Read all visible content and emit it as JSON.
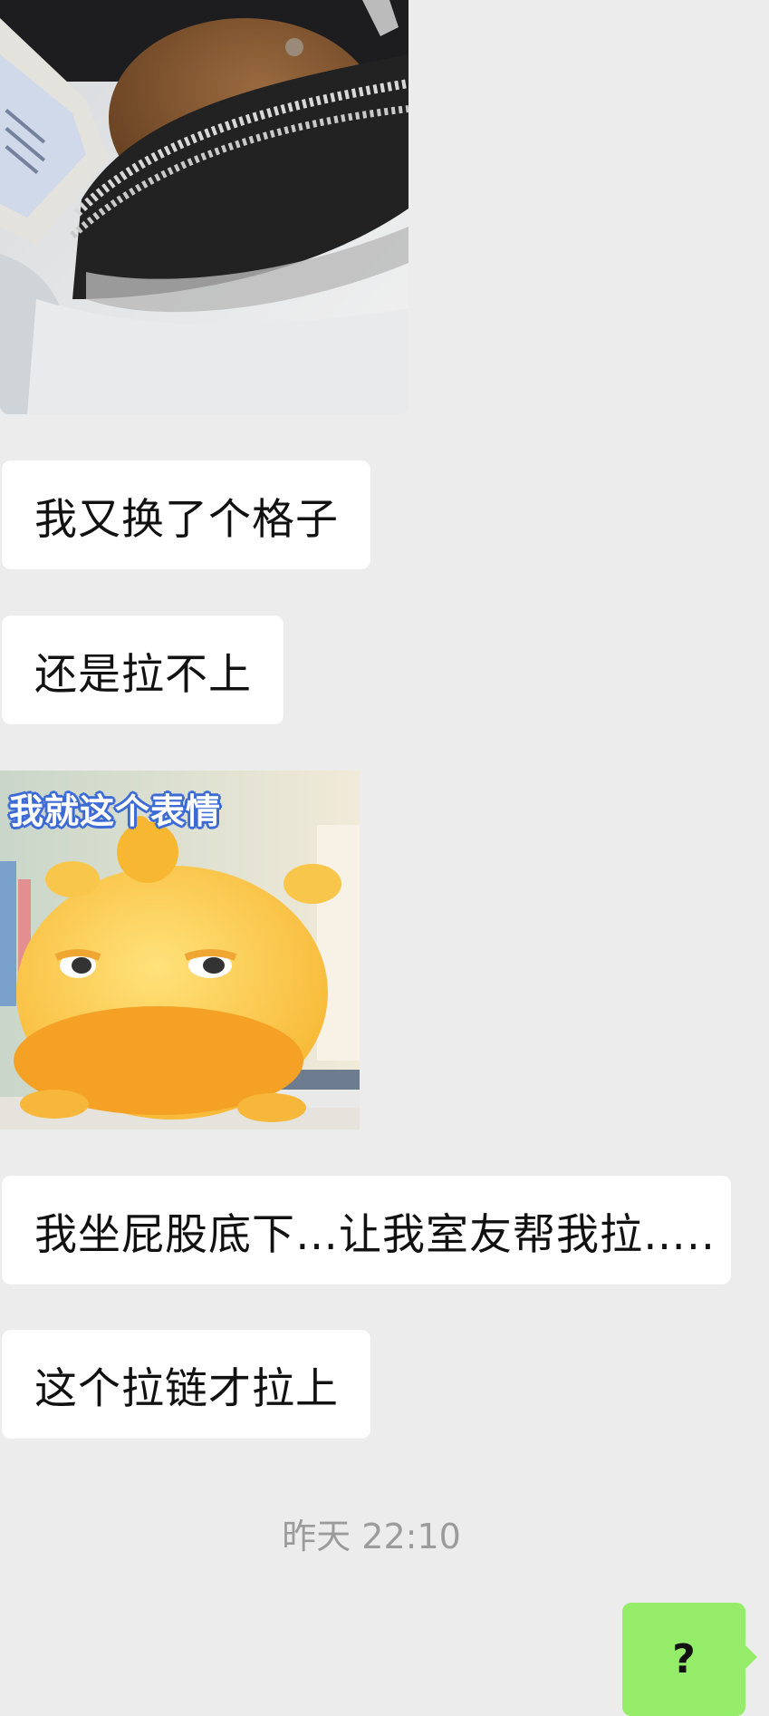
{
  "messages": [
    {
      "type": "image",
      "from": "other",
      "description_icon": "photo-zipper-pouch"
    },
    {
      "type": "text",
      "from": "other",
      "text": "我又换了个格子"
    },
    {
      "type": "text",
      "from": "other",
      "text": "还是拉不上"
    },
    {
      "type": "sticker",
      "from": "other",
      "caption": "我就这个表情"
    },
    {
      "type": "text",
      "from": "other",
      "text": "我坐屁股底下…让我室友帮我拉….."
    },
    {
      "type": "text",
      "from": "other",
      "text": "这个拉链才拉上"
    }
  ],
  "timestamp": "昨天 22:10",
  "outgoing": {
    "text": "?"
  },
  "colors": {
    "background": "#ececec",
    "incoming_bubble": "#ffffff",
    "outgoing_bubble": "#95ec69",
    "timestamp": "#9b9b9b"
  }
}
